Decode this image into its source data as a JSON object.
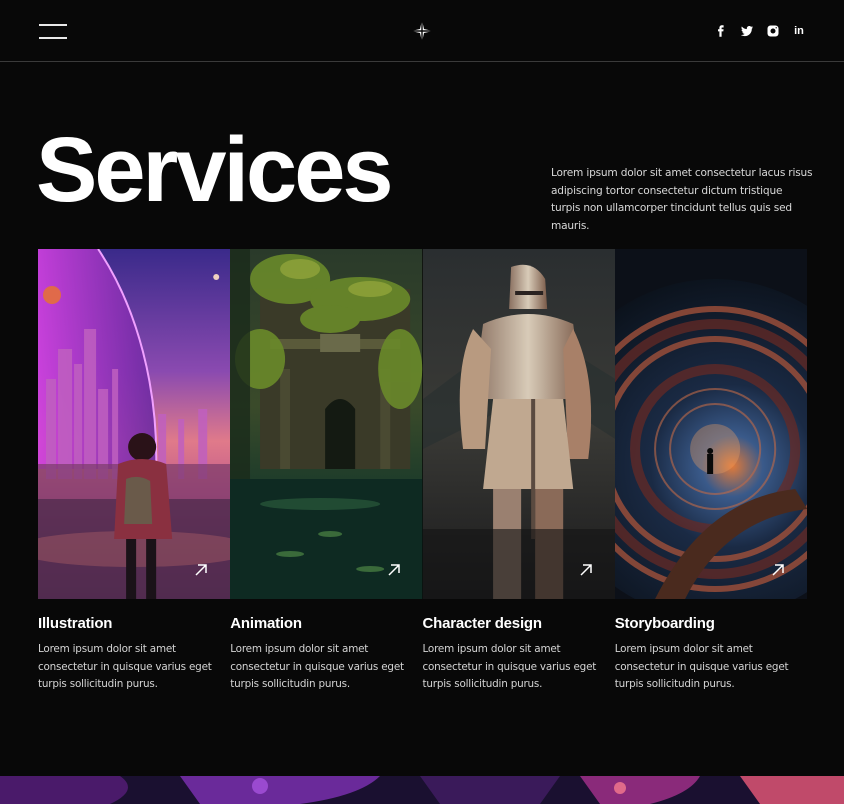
{
  "header": {
    "menu_icon": "hamburger-menu-icon",
    "logo_icon": "four-point-star-logo",
    "socials": [
      {
        "name": "facebook",
        "icon": "facebook-icon"
      },
      {
        "name": "twitter",
        "icon": "twitter-icon"
      },
      {
        "name": "instagram",
        "icon": "instagram-icon"
      },
      {
        "name": "linkedin",
        "icon": "linkedin-icon",
        "glyph": "in"
      }
    ]
  },
  "hero": {
    "title": "Services",
    "description": "Lorem ipsum dolor sit amet consectetur lacus risus adipiscing tortor consectetur dictum tristique turpis non ullamcorper tincidunt tellus quis sed mauris."
  },
  "services": [
    {
      "title": "Illustration",
      "description": "Lorem ipsum dolor sit amet consectetur in quisque varius eget turpis sollicitudin purus.",
      "image": "futuristic city with girl"
    },
    {
      "title": "Animation",
      "description": "Lorem ipsum dolor sit amet consectetur in quisque varius eget turpis sollicitudin purus.",
      "image": "overgrown jungle ruins"
    },
    {
      "title": "Character design",
      "description": "Lorem ipsum dolor sit amet consectetur in quisque varius eget turpis sollicitudin purus.",
      "image": "armored knight"
    },
    {
      "title": "Storyboarding",
      "description": "Lorem ipsum dolor sit amet consectetur in quisque varius eget turpis sollicitudin purus.",
      "image": "ornate spiral portal"
    }
  ],
  "colors": {
    "background": "#080808",
    "text": "#ffffff",
    "muted": "#d4d4d4",
    "divider": "#3a3a3a"
  }
}
